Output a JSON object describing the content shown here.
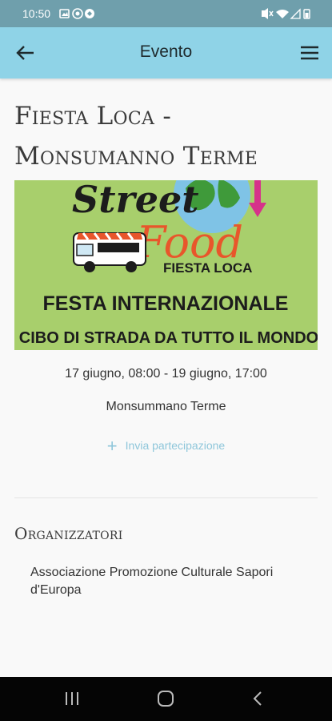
{
  "status_bar": {
    "time": "10:50"
  },
  "app_bar": {
    "title": "Evento"
  },
  "event": {
    "title": "Fiesta Loca - Monsumanno Terme",
    "date_range": "17 giugno, 08:00 - 19 giugno, 17:00",
    "location": "Monsummano Terme",
    "participate_label": "Invia partecipazione",
    "banner": {
      "street": "Street",
      "food": "Food",
      "fiesta": "FIESTA LOCA",
      "headline": "FESTA INTERNAZIONALE",
      "tagline": "CIBO DI STRADA DA TUTTO IL MONDO"
    }
  },
  "organizers": {
    "section_title": "Organizzatori",
    "items": [
      "Associazione Promozione Culturale Sapori d'Europa"
    ]
  },
  "colors": {
    "app_bar": "#8fd3e7",
    "status_bar": "#6f9fac",
    "accent": "#8ec6da",
    "banner_bg": "#a8cf6c"
  }
}
